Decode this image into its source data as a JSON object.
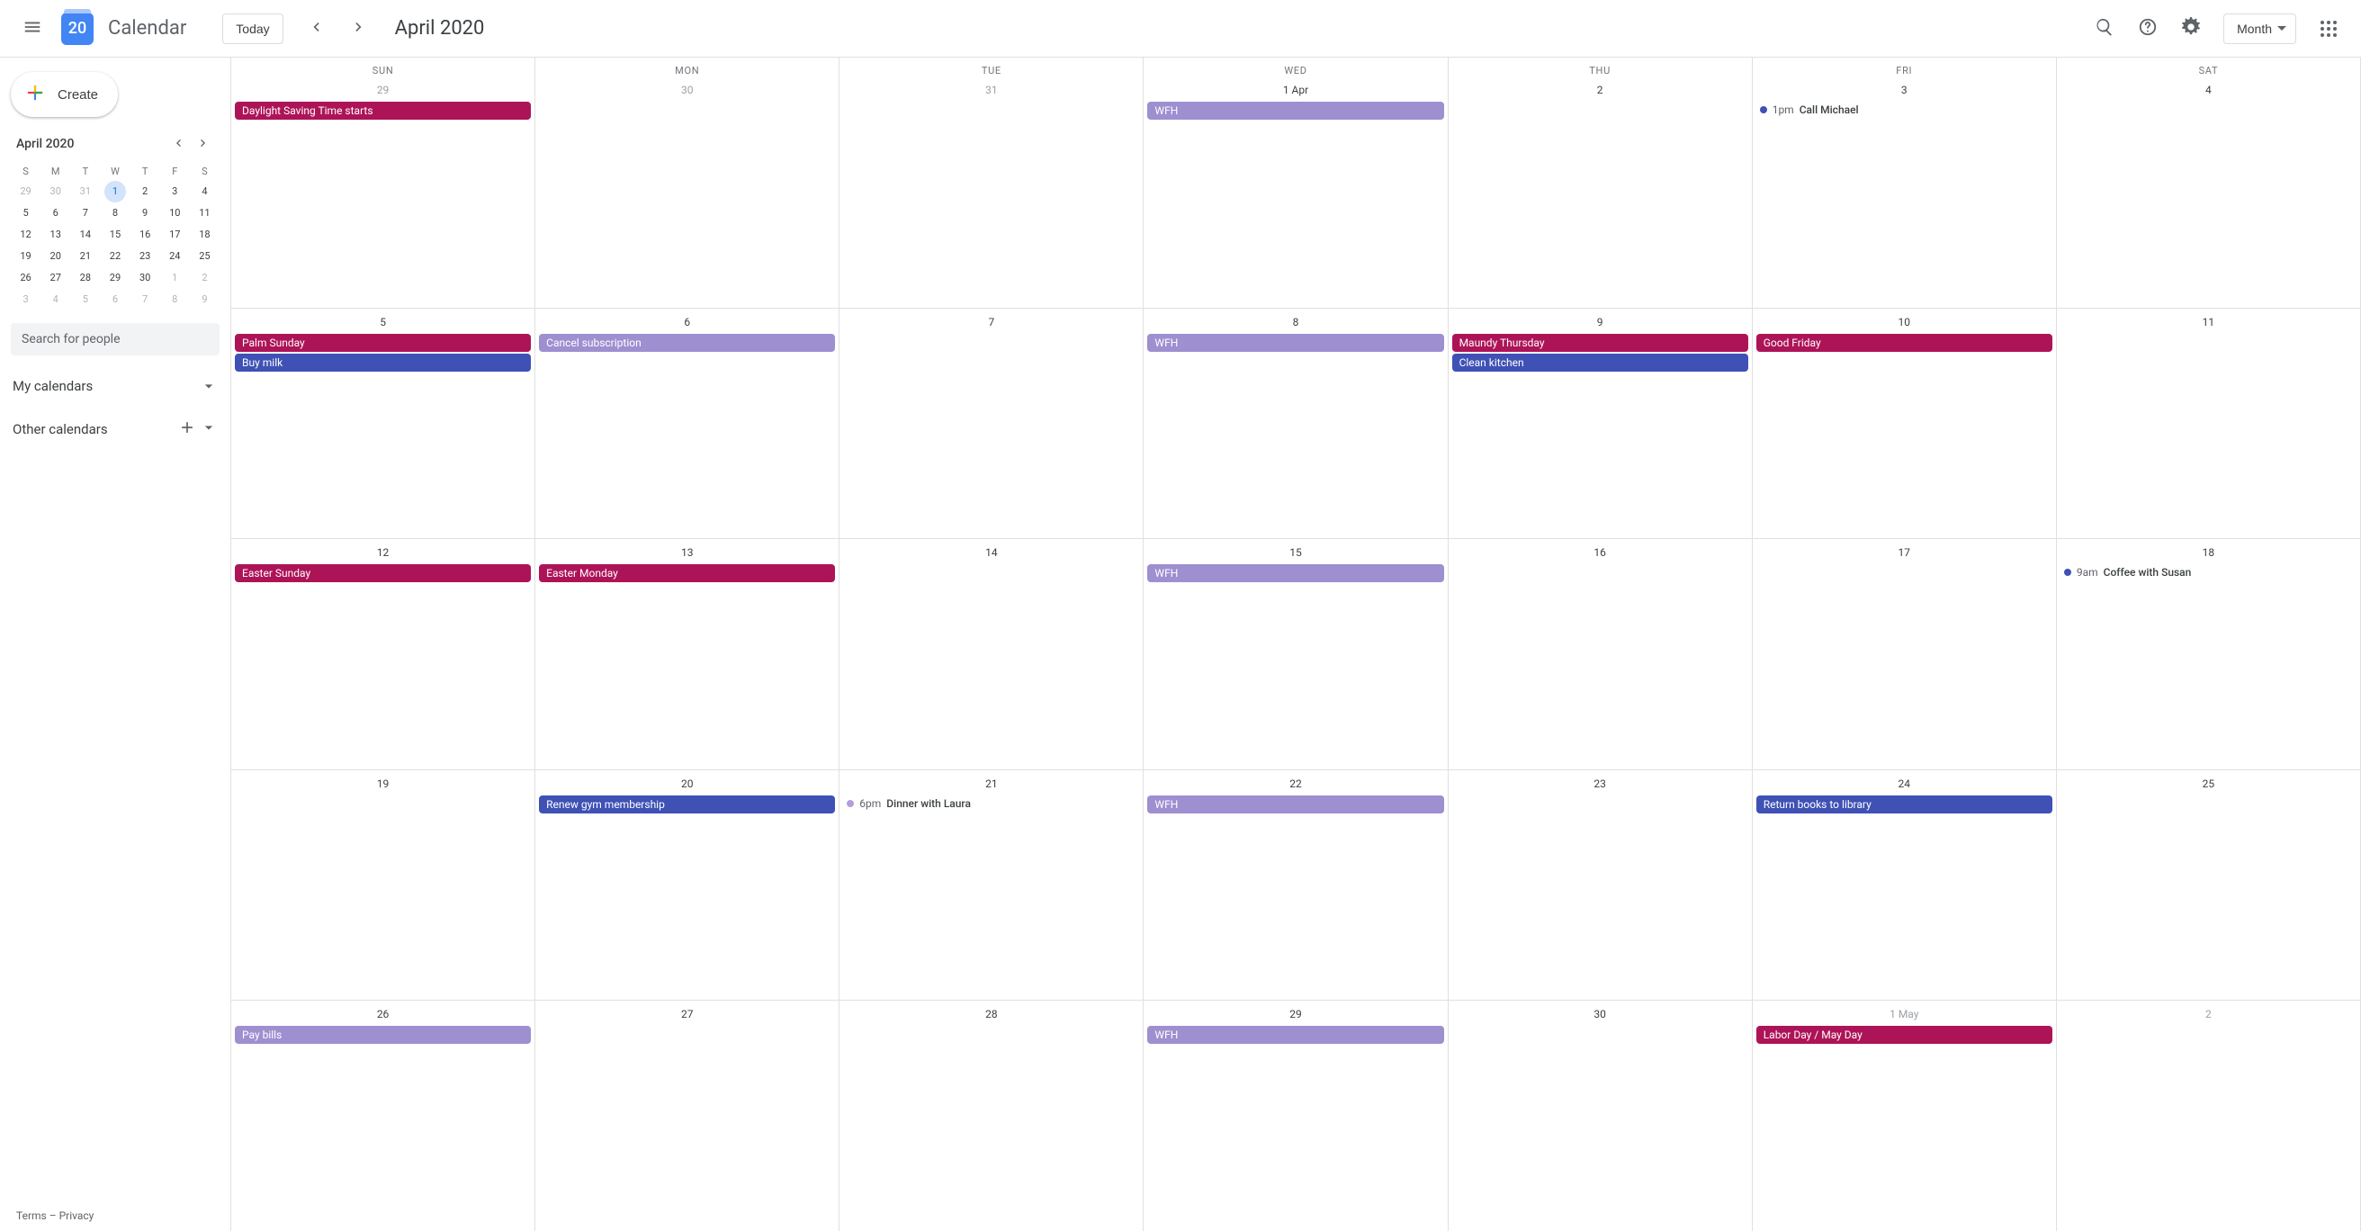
{
  "colors": {
    "holiday": "#ad1457",
    "task": "#3f51b5",
    "wfh": "#9e8fd0",
    "taskDot": "#3f51b5",
    "otherDot": "#b39ddb"
  },
  "header": {
    "logo_day": "20",
    "product_name": "Calendar",
    "today_label": "Today",
    "title": "April 2020",
    "view_label": "Month"
  },
  "sidebar": {
    "create_label": "Create",
    "mini_title": "April 2020",
    "dow": [
      "S",
      "M",
      "T",
      "W",
      "T",
      "F",
      "S"
    ],
    "mini_grid": [
      [
        {
          "n": "29",
          "om": true
        },
        {
          "n": "30",
          "om": true
        },
        {
          "n": "31",
          "om": true
        },
        {
          "n": "1",
          "today": true
        },
        {
          "n": "2"
        },
        {
          "n": "3"
        },
        {
          "n": "4"
        }
      ],
      [
        {
          "n": "5"
        },
        {
          "n": "6"
        },
        {
          "n": "7"
        },
        {
          "n": "8"
        },
        {
          "n": "9"
        },
        {
          "n": "10"
        },
        {
          "n": "11"
        }
      ],
      [
        {
          "n": "12"
        },
        {
          "n": "13"
        },
        {
          "n": "14"
        },
        {
          "n": "15"
        },
        {
          "n": "16"
        },
        {
          "n": "17"
        },
        {
          "n": "18"
        }
      ],
      [
        {
          "n": "19"
        },
        {
          "n": "20"
        },
        {
          "n": "21"
        },
        {
          "n": "22"
        },
        {
          "n": "23"
        },
        {
          "n": "24"
        },
        {
          "n": "25"
        }
      ],
      [
        {
          "n": "26"
        },
        {
          "n": "27"
        },
        {
          "n": "28"
        },
        {
          "n": "29"
        },
        {
          "n": "30"
        },
        {
          "n": "1",
          "om": true
        },
        {
          "n": "2",
          "om": true
        }
      ],
      [
        {
          "n": "3",
          "om": true
        },
        {
          "n": "4",
          "om": true
        },
        {
          "n": "5",
          "om": true
        },
        {
          "n": "6",
          "om": true
        },
        {
          "n": "7",
          "om": true
        },
        {
          "n": "8",
          "om": true
        },
        {
          "n": "9",
          "om": true
        }
      ]
    ],
    "search_placeholder": "Search for people",
    "my_calendars_label": "My calendars",
    "other_calendars_label": "Other calendars",
    "terms_label": "Terms",
    "privacy_label": "Privacy"
  },
  "grid": {
    "dow": [
      "SUN",
      "MON",
      "TUE",
      "WED",
      "THU",
      "FRI",
      "SAT"
    ],
    "weeks": [
      [
        {
          "date": "29",
          "om": true,
          "events": [
            {
              "type": "chip",
              "color": "holiday",
              "text": "Daylight Saving Time starts"
            }
          ]
        },
        {
          "date": "30",
          "om": true,
          "events": []
        },
        {
          "date": "31",
          "om": true,
          "events": []
        },
        {
          "date": "1 Apr",
          "events": [
            {
              "type": "chip",
              "color": "wfh",
              "text": "WFH"
            }
          ]
        },
        {
          "date": "2",
          "events": []
        },
        {
          "date": "3",
          "events": [
            {
              "type": "timed",
              "dot": "taskDot",
              "time": "1pm",
              "title": "Call Michael"
            }
          ]
        },
        {
          "date": "4",
          "events": []
        }
      ],
      [
        {
          "date": "5",
          "events": [
            {
              "type": "chip",
              "color": "holiday",
              "text": "Palm Sunday"
            },
            {
              "type": "chip",
              "color": "task",
              "text": "Buy milk"
            }
          ]
        },
        {
          "date": "6",
          "events": [
            {
              "type": "chip",
              "color": "wfh",
              "text": "Cancel subscription"
            }
          ]
        },
        {
          "date": "7",
          "events": []
        },
        {
          "date": "8",
          "events": [
            {
              "type": "chip",
              "color": "wfh",
              "text": "WFH"
            }
          ]
        },
        {
          "date": "9",
          "events": [
            {
              "type": "chip",
              "color": "holiday",
              "text": "Maundy Thursday"
            },
            {
              "type": "chip",
              "color": "task",
              "text": "Clean kitchen"
            }
          ]
        },
        {
          "date": "10",
          "events": [
            {
              "type": "chip",
              "color": "holiday",
              "text": "Good Friday"
            }
          ]
        },
        {
          "date": "11",
          "events": []
        }
      ],
      [
        {
          "date": "12",
          "events": [
            {
              "type": "chip",
              "color": "holiday",
              "text": "Easter Sunday"
            }
          ]
        },
        {
          "date": "13",
          "events": [
            {
              "type": "chip",
              "color": "holiday",
              "text": "Easter Monday"
            }
          ]
        },
        {
          "date": "14",
          "events": []
        },
        {
          "date": "15",
          "events": [
            {
              "type": "chip",
              "color": "wfh",
              "text": "WFH"
            }
          ]
        },
        {
          "date": "16",
          "events": []
        },
        {
          "date": "17",
          "events": []
        },
        {
          "date": "18",
          "events": [
            {
              "type": "timed",
              "dot": "taskDot",
              "time": "9am",
              "title": "Coffee with Susan"
            }
          ]
        }
      ],
      [
        {
          "date": "19",
          "events": []
        },
        {
          "date": "20",
          "events": [
            {
              "type": "chip",
              "color": "task",
              "text": "Renew gym membership"
            }
          ]
        },
        {
          "date": "21",
          "events": [
            {
              "type": "timed",
              "dot": "otherDot",
              "time": "6pm",
              "title": "Dinner with Laura"
            }
          ]
        },
        {
          "date": "22",
          "events": [
            {
              "type": "chip",
              "color": "wfh",
              "text": "WFH"
            }
          ]
        },
        {
          "date": "23",
          "events": []
        },
        {
          "date": "24",
          "events": [
            {
              "type": "chip",
              "color": "task",
              "text": "Return books to library"
            }
          ]
        },
        {
          "date": "25",
          "events": []
        }
      ],
      [
        {
          "date": "26",
          "events": [
            {
              "type": "chip",
              "color": "wfh",
              "text": "Pay bills"
            }
          ]
        },
        {
          "date": "27",
          "events": []
        },
        {
          "date": "28",
          "events": []
        },
        {
          "date": "29",
          "events": [
            {
              "type": "chip",
              "color": "wfh",
              "text": "WFH"
            }
          ]
        },
        {
          "date": "30",
          "events": []
        },
        {
          "date": "1 May",
          "om": true,
          "events": [
            {
              "type": "chip",
              "color": "holiday",
              "text": "Labor Day / May Day"
            }
          ]
        },
        {
          "date": "2",
          "om": true,
          "events": []
        }
      ]
    ]
  }
}
